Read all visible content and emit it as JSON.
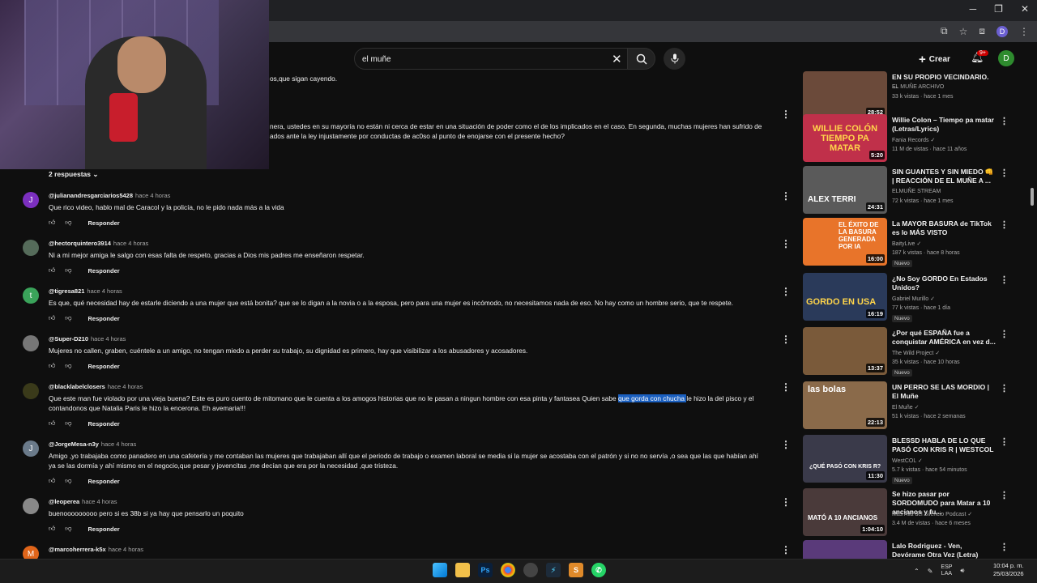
{
  "search": {
    "value": "el muñe",
    "placeholder": "Buscar"
  },
  "header": {
    "create_label": "Crear",
    "notif_badge": "9+",
    "avatar_letter": "D",
    "browser_profile": "D"
  },
  "partial_comments": {
    "top_line": "os,que sigan cayendo.",
    "long_line1": "nera, ustedes en su mayoría no están ni cerca de estar en una situación de poder como el de los implicados en el caso. En segunda, muchas mujeres han sufrido de",
    "long_line2": "ados ante la ley injustamente por conductas de ac0so al punto de enojarse con el presente hecho?",
    "replies_label": "2 respuestas"
  },
  "reply_label": "Responder",
  "comments": [
    {
      "author": "@julianandresgarciarios5428",
      "time": "hace 4 horas",
      "avatar": "J",
      "avatar_color": "#7b2fbf",
      "lines": [
        "Que rico video, hablo mal de Caracol y la policía, no le pido nada más a la vida"
      ]
    },
    {
      "author": "@hectorquintero3914",
      "time": "hace 4 horas",
      "avatar": "",
      "avatar_color": "#556b5a",
      "lines": [
        "Ni a mi mejor amiga le salgo con esas falta de respeto, gracias a Dios mis padres me enseñaron respetar."
      ]
    },
    {
      "author": "@tigresa821",
      "time": "hace 4 horas",
      "avatar": "t",
      "avatar_color": "#3aa35a",
      "lines": [
        "Es que, qué necesidad hay de estarle diciendo a una mujer que está bonita? que se lo digan a la novia o a la esposa, pero para una mujer es incómodo, no necesitamos nada de eso. No hay como un hombre serio, que te respete."
      ]
    },
    {
      "author": "@Super-D210",
      "time": "hace 4 horas",
      "avatar": "",
      "avatar_color": "#777777",
      "lines": [
        "Mujeres no callen, graben, cuéntele a un amigo, no tengan miedo a perder su trabajo, su dignidad es primero, hay que visibilizar a los abusadores y acosadores."
      ]
    },
    {
      "author": "@blacklabelclosers",
      "time": "hace 4 horas",
      "avatar": "",
      "avatar_color": "#3a3a1a",
      "lines_pre": "Que este man fue violado por una vieja buena?  Este es puro cuento de mitomano que le cuenta a los amogos historias que no le pasan a ningun hombre con esa pinta y fantasea  Quien sabe ",
      "highlight": "que gorda con chucha ",
      "lines_post": "le hizo la del pisco y el",
      "line2": "contandonos que Natalia Paris le hizo la encerona.   Eh avemaria!!!"
    },
    {
      "author": "@JorgeMesa-n3y",
      "time": "hace 4 horas",
      "avatar": "J",
      "avatar_color": "#6a7a8a",
      "lines": [
        "Amigo ,yo trabajaba como panadero en una cafetería y me contaban las mujeres que trabajaban allí que el periodo de trabajo o examen laboral se media si la mujer se acostaba con el patrón y si no no servía ,o sea que las que habían ahí",
        "ya se las dormía y ahí mismo en el negocio,que pesar y jovencitas ,me decían que era por la necesidad ,que tristeza."
      ]
    },
    {
      "author": "@leoperea",
      "time": "hace 4 horas",
      "avatar": "",
      "avatar_color": "#888888",
      "lines": [
        "buenooooooooo pero si es 38b si ya hay que pensarlo un poquito"
      ]
    },
    {
      "author": "@marcoherrera-k5x",
      "time": "hace 4 horas",
      "avatar": "M",
      "avatar_color": "#e0651a",
      "lines": []
    }
  ],
  "recommendations": [
    {
      "title": "EN SU PROPIO VECINDARIO. ...",
      "channel": "EL MUÑE ARCHIVO",
      "verified": false,
      "meta": "33 k vistas · hace 1 mes",
      "duration": "28:52",
      "new": false,
      "thumb_color": "#6b4a3a"
    },
    {
      "title": "Willie Colon – Tiempo pa matar (Letras/Lyrics)",
      "channel": "Fania Records",
      "verified": true,
      "meta": "11 M de vistas · hace 11 años",
      "duration": "5:20",
      "new": false,
      "thumb_color": "#c0304a",
      "thumb_text": "WILLIE COLÓN TIEMPO PA MATAR"
    },
    {
      "title": "SIN GUANTES Y SIN MIEDO 👊 | REACCIÓN DE EL MUÑE A ...",
      "channel": "ELMUÑE STREAM",
      "verified": false,
      "meta": "72 k vistas · hace 1 mes",
      "duration": "24:31",
      "new": false,
      "thumb_color": "#5a5a5a",
      "thumb_text": "ALEX TERRI"
    },
    {
      "title": "La MAYOR BASURA de TikTok es lo MÁS VISTO",
      "channel": "BaityLive",
      "verified": true,
      "meta": "187 k vistas · hace 8 horas",
      "duration": "16:00",
      "new": true,
      "thumb_color": "#e8742a",
      "thumb_text": "EL ÉXITO DE LA BASURA GENERADA POR IA"
    },
    {
      "title": "¿No Soy GORDO En Estados Unidos?",
      "channel": "Gabriel Murillo",
      "verified": true,
      "meta": "77 k vistas · hace 1 día",
      "duration": "16:19",
      "new": true,
      "thumb_color": "#2a3a5a",
      "thumb_text": "GORDO EN USA"
    },
    {
      "title": "¿Por qué ESPAÑA fue a conquistar AMÉRICA en vez d...",
      "channel": "The Wild Project",
      "verified": true,
      "meta": "35 k vistas · hace 10 horas",
      "duration": "13:37",
      "new": true,
      "thumb_color": "#7a5a3a"
    },
    {
      "title": "UN PERRO SE LAS MORDIO | El Muñe",
      "channel": "El Muñe",
      "verified": true,
      "meta": "51 k vistas · hace 2 semanas",
      "duration": "22:13",
      "new": false,
      "thumb_color": "#8a6a4a",
      "thumb_text": "las bolas"
    },
    {
      "title": "BLESSD HABLA DE LO QUE PASÓ CON KRIS R | WESTCOL",
      "channel": "WestCOL",
      "verified": true,
      "meta": "5.7 k vistas · hace 54 minutos",
      "duration": "11:30",
      "new": true,
      "thumb_color": "#3a3a4a",
      "thumb_text": "¿QUÉ PASÓ CON KRIS R?"
    },
    {
      "title": "Se hizo pasar por SORDOMUDO para Matar a 10 ancianos y fu...",
      "channel": "Más Allá del Silencio Podcast",
      "verified": true,
      "meta": "3.4 M de vistas · hace 6 meses",
      "duration": "1:04:10",
      "new": false,
      "thumb_color": "#4a3a3a",
      "thumb_text": "MATÓ A 10 ANCIANOS"
    },
    {
      "title": "Lalo Rodriguez - Ven, Devórame Otra Vez (Letra)",
      "channel": "",
      "verified": false,
      "meta": "",
      "duration": "",
      "new": false,
      "thumb_color": "#5a3a7a"
    }
  ],
  "taskbar": {
    "lang_top": "ESP",
    "lang_bottom": "LAA",
    "time": "10:04 p. m.",
    "date": "25/03/2026"
  }
}
